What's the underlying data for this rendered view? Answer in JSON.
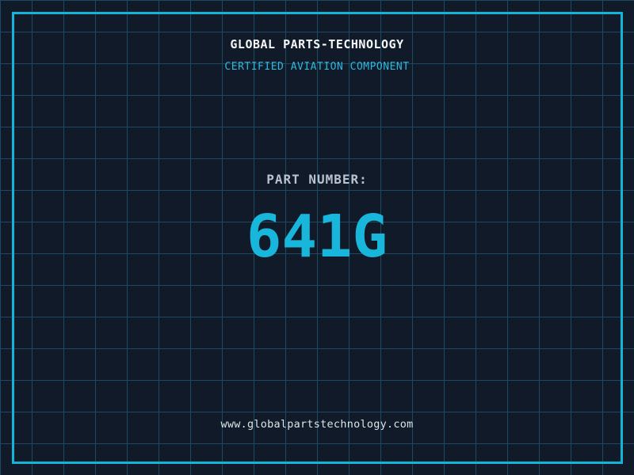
{
  "header": {
    "title": "GLOBAL PARTS-TECHNOLOGY",
    "subtitle": "CERTIFIED AVIATION COMPONENT"
  },
  "part": {
    "label": "PART NUMBER:",
    "number": "641G"
  },
  "footer": {
    "url": "www.globalpartstechnology.com"
  },
  "colors": {
    "background": "#101a29",
    "grid_line": "#1c4a60",
    "frame": "#12b4da",
    "title_text": "#f4f6f8",
    "subtitle_text": "#30b7dc",
    "part_label_text": "#b8c3cf",
    "part_number_text": "#19b6db",
    "footer_text": "#dde3e8"
  }
}
